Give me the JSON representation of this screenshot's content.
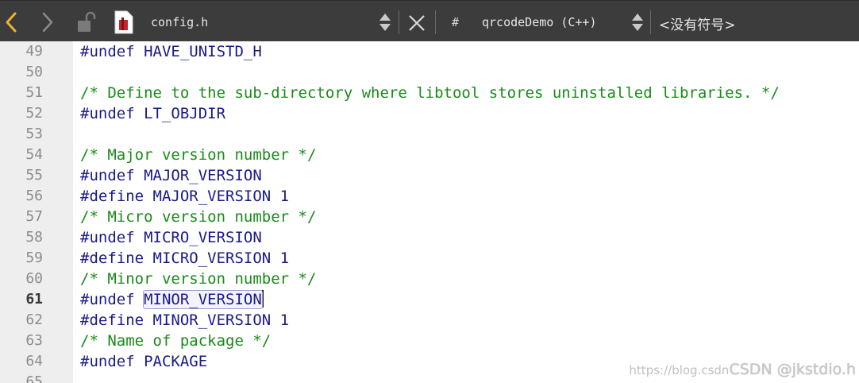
{
  "window": {
    "file_name": "config.h",
    "hash_label": "#",
    "symbol_context": "qrcodeDemo (C++)",
    "symbol_selector": "<没有符号>"
  },
  "colors": {
    "toolbar_bg": "#3c3c3c",
    "back_arrow": "#f0b030",
    "gutter_bg": "#eeeeee",
    "keyword": "#1a1a8a",
    "comment": "#1a8a1a"
  },
  "icons": [
    "back-arrow-icon",
    "forward-arrow-icon",
    "unlock-icon",
    "file-type-icon",
    "updown-icon",
    "close-icon"
  ],
  "editor": {
    "current_line": "61",
    "lines": [
      {
        "num": "49",
        "text": "#undef HAVE_UNISTD_H",
        "kind": "code"
      },
      {
        "num": "50",
        "text": "",
        "kind": "code"
      },
      {
        "num": "51",
        "text": "/* Define to the sub-directory where libtool stores uninstalled libraries. */",
        "kind": "comment"
      },
      {
        "num": "52",
        "text": "#undef LT_OBJDIR",
        "kind": "code"
      },
      {
        "num": "53",
        "text": "",
        "kind": "code"
      },
      {
        "num": "54",
        "text": "/* Major version number */",
        "kind": "comment"
      },
      {
        "num": "55",
        "text": "#undef MAJOR_VERSION",
        "kind": "code"
      },
      {
        "num": "56",
        "text": "#define MAJOR_VERSION 1",
        "kind": "code"
      },
      {
        "num": "57",
        "text": "/* Micro version number */",
        "kind": "comment"
      },
      {
        "num": "58",
        "text": "#undef MICRO_VERSION",
        "kind": "code"
      },
      {
        "num": "59",
        "text": "#define MICRO_VERSION 1",
        "kind": "code"
      },
      {
        "num": "60",
        "text": "/* Minor version number */",
        "kind": "comment"
      },
      {
        "num": "61",
        "text_prefix": "#undef ",
        "text_highlight": "MINOR_VERSION",
        "kind": "current"
      },
      {
        "num": "62",
        "text": "#define MINOR_VERSION 1",
        "kind": "code"
      },
      {
        "num": "63",
        "text": "/* Name of package */",
        "kind": "comment"
      },
      {
        "num": "64",
        "text": "#undef PACKAGE",
        "kind": "code"
      },
      {
        "num": "65",
        "text": "",
        "kind": "code"
      }
    ]
  },
  "watermark": {
    "url": "https://blog.csdn",
    "brand": "CSDN @jkstdio.h"
  }
}
